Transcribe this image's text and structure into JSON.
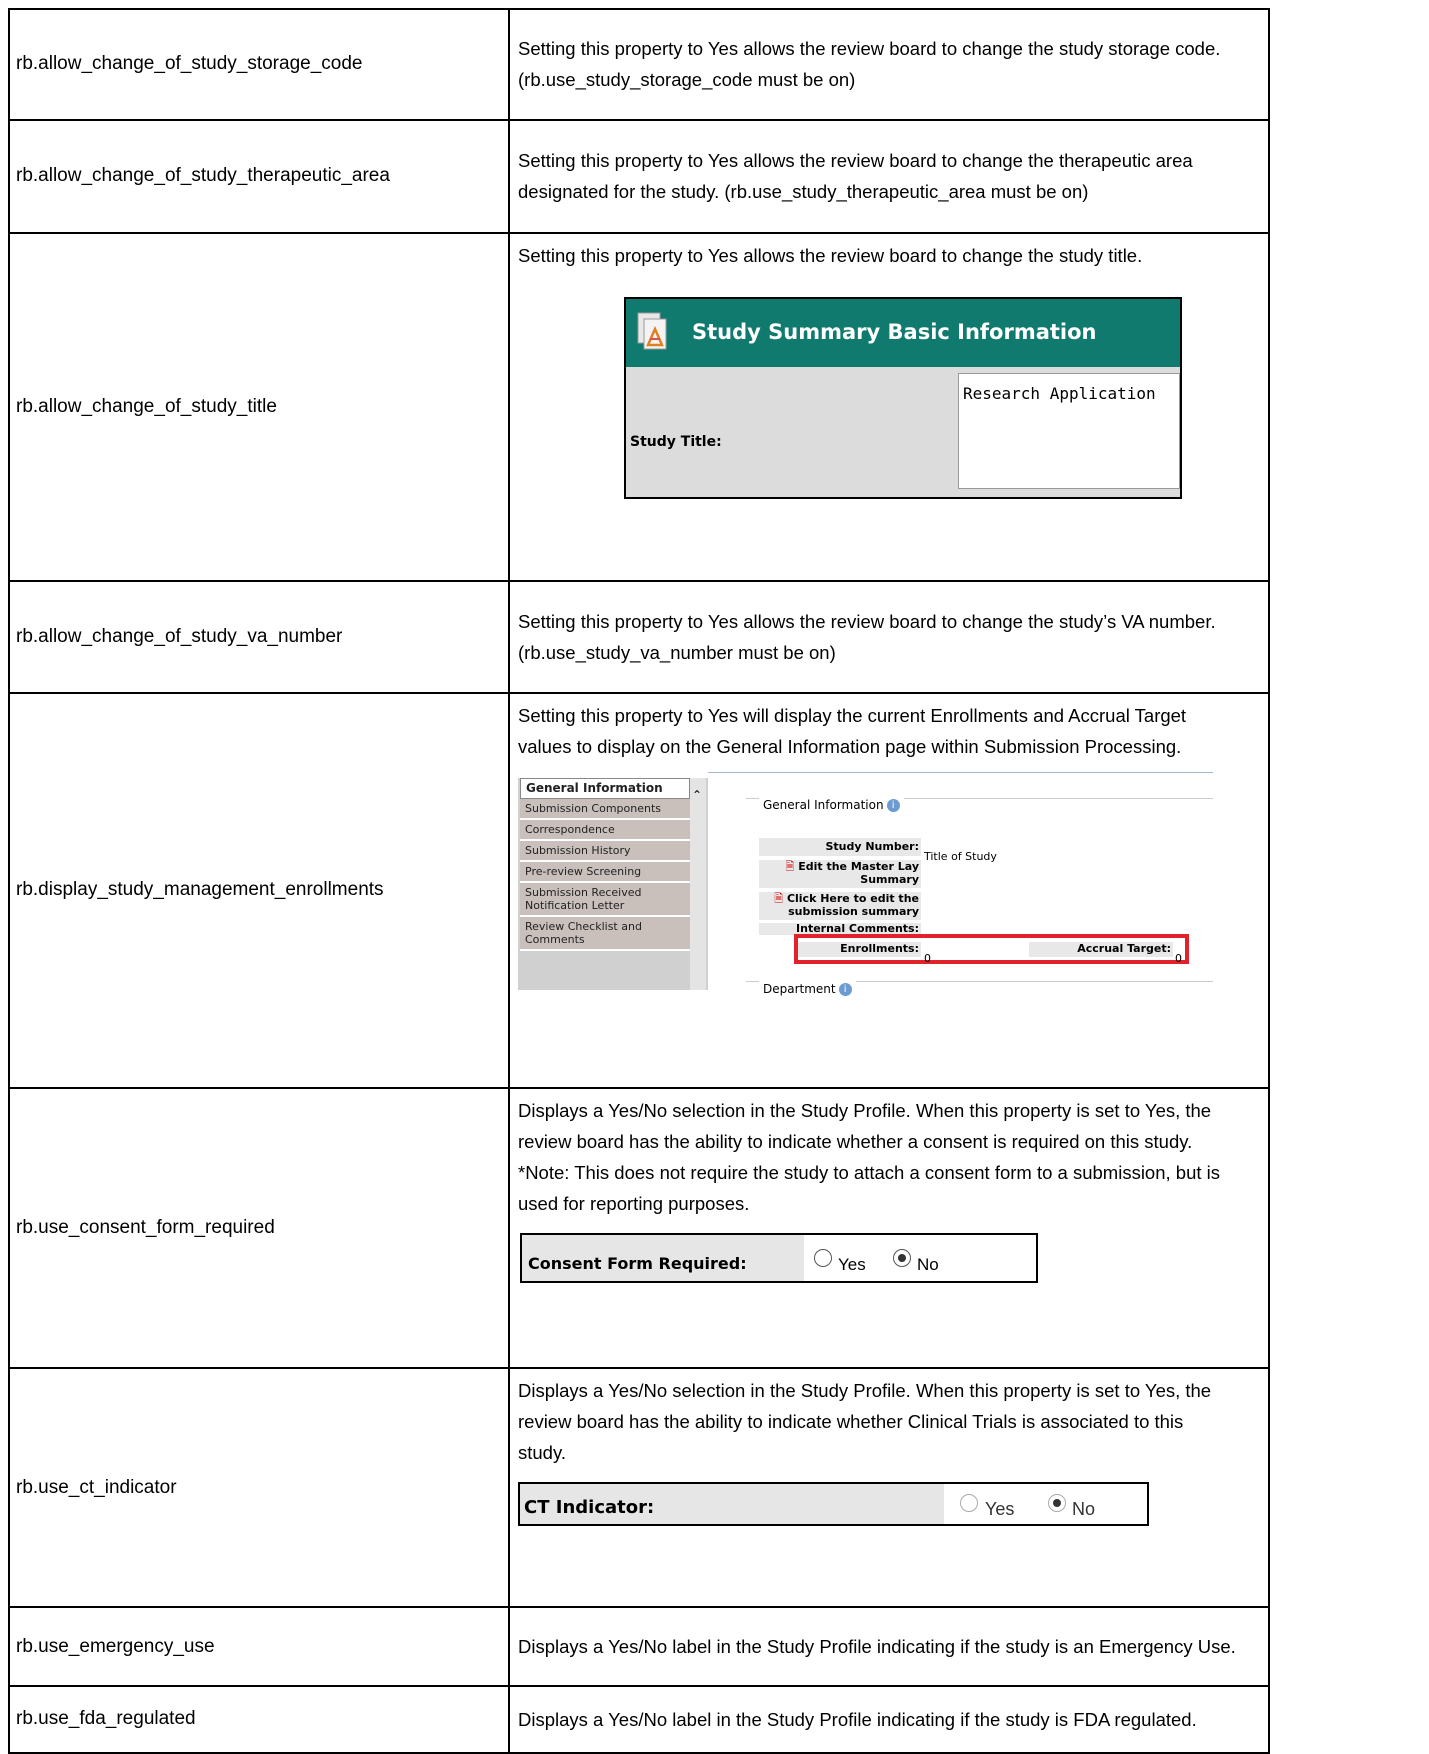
{
  "rows": [
    {
      "name": "rb.allow_change_of_study_storage_code",
      "desc_lines": [
        "Setting this property to Yes allows the review board to change the study storage code.",
        "(rb.use_study_storage_code must be on)"
      ]
    },
    {
      "name": "rb.allow_change_of_study_therapeutic_area",
      "desc_lines": [
        "Setting this property to Yes allows the review board to change the therapeutic area",
        "designated for the study.  (rb.use_study_therapeutic_area must be on)"
      ]
    },
    {
      "name": "rb.allow_change_of_study_title",
      "desc_lines": [
        "Setting this property to Yes allows the review board to change the study title."
      ]
    },
    {
      "name": "rb.allow_change_of_study_va_number",
      "desc_lines": [
        "Setting this property to Yes allows the review board to change the study’s VA number.",
        "(rb.use_study_va_number must be on)"
      ]
    },
    {
      "name": "rb.display_study_management_enrollments",
      "desc_lines": [
        "Setting this property to Yes will display the current Enrollments and Accrual Target",
        "values to display on the General Information page within Submission Processing."
      ]
    },
    {
      "name": "rb.use_consent_form_required",
      "desc_lines": [
        "Displays a Yes/No selection in the Study Profile. When this property is set to Yes, the",
        "review board has the ability to indicate whether a consent is required on this study.",
        "*Note: This does not require the study to attach a consent form to a submission, but is",
        "used for reporting purposes."
      ]
    },
    {
      "name": "rb.use_ct_indicator",
      "desc_lines": [
        "Displays a Yes/No selection in the Study Profile. When this property is set to Yes, the",
        "review board has the ability to indicate whether Clinical Trials is associated to this",
        "study."
      ]
    },
    {
      "name": "rb.use_emergency_use",
      "desc_lines": [
        "Displays a Yes/No label in the Study Profile indicating if the study is an Emergency Use."
      ]
    },
    {
      "name": "rb.use_fda_regulated",
      "desc_lines": [
        "Displays a Yes/No label in the Study Profile indicating if the study is FDA regulated."
      ]
    }
  ],
  "study_summary": {
    "header": "Study Summary Basic Information",
    "field_label": "Study Title:",
    "field_value": "Research Application",
    "header_color": "#107a6e"
  },
  "general_info": {
    "menu": [
      "General Information",
      "Submission Components",
      "Correspondence",
      "Submission History",
      "Pre-review Screening",
      "Submission Received Notification Letter",
      "Review Checklist and Comments"
    ],
    "section_title": "General Information",
    "study_number_label": "Study Number:",
    "study_number_value": "Title of Study",
    "edit_lay_summary": "Edit the Master Lay Summary",
    "edit_submission_summary": "Click Here to edit the submission summary",
    "internal_comments_label": "Internal Comments:",
    "enrollments_label": "Enrollments:",
    "enrollments_value": "0",
    "accrual_label": "Accrual Target:",
    "accrual_value": "0",
    "department_label": "Department",
    "highlight_color": "#e2222a"
  },
  "consent_form": {
    "label": "Consent Form Required:",
    "options": [
      "Yes",
      "No"
    ],
    "selected": "No"
  },
  "ct_indicator": {
    "label": "CT Indicator:",
    "options": [
      "Yes",
      "No"
    ],
    "selected": "No"
  }
}
